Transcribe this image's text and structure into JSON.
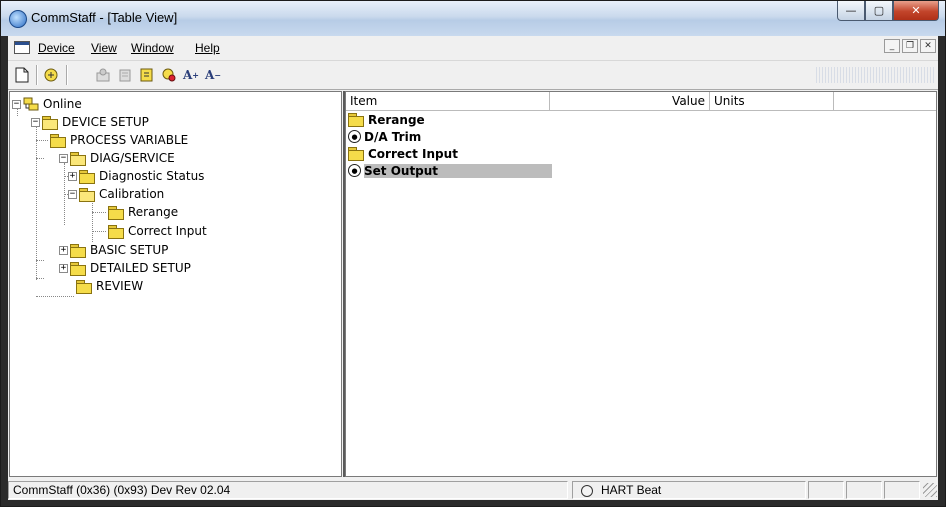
{
  "window": {
    "title": "CommStaff - [Table View]"
  },
  "menu": {
    "device": "Device",
    "view": "View",
    "window": "Window",
    "help": "Help"
  },
  "toolbar": {
    "font_larger": "A",
    "font_smaller": "A"
  },
  "tree": {
    "online": "Online",
    "device_setup": "DEVICE SETUP",
    "process_variable": "PROCESS VARIABLE",
    "diag_service": "DIAG/SERVICE",
    "diagnostic_status": "Diagnostic Status",
    "calibration": "Calibration",
    "rerange": "Rerange",
    "correct_input": "Correct Input",
    "basic_setup": "BASIC SETUP",
    "detailed_setup": "DETAILED SETUP",
    "review": "REVIEW"
  },
  "list": {
    "columns": {
      "item": "Item",
      "value": "Value",
      "units": "Units"
    },
    "rows": [
      {
        "label": "Rerange",
        "icon": "folder-icon"
      },
      {
        "label": "D/A Trim",
        "icon": "method-icon"
      },
      {
        "label": "Correct Input",
        "icon": "folder-icon"
      },
      {
        "label": "Set Output",
        "icon": "method-icon",
        "selected": true
      }
    ]
  },
  "status": {
    "device_info": "CommStaff  (0x36)  (0x93) Dev Rev 02.04",
    "hart_beat": "HART Beat"
  }
}
